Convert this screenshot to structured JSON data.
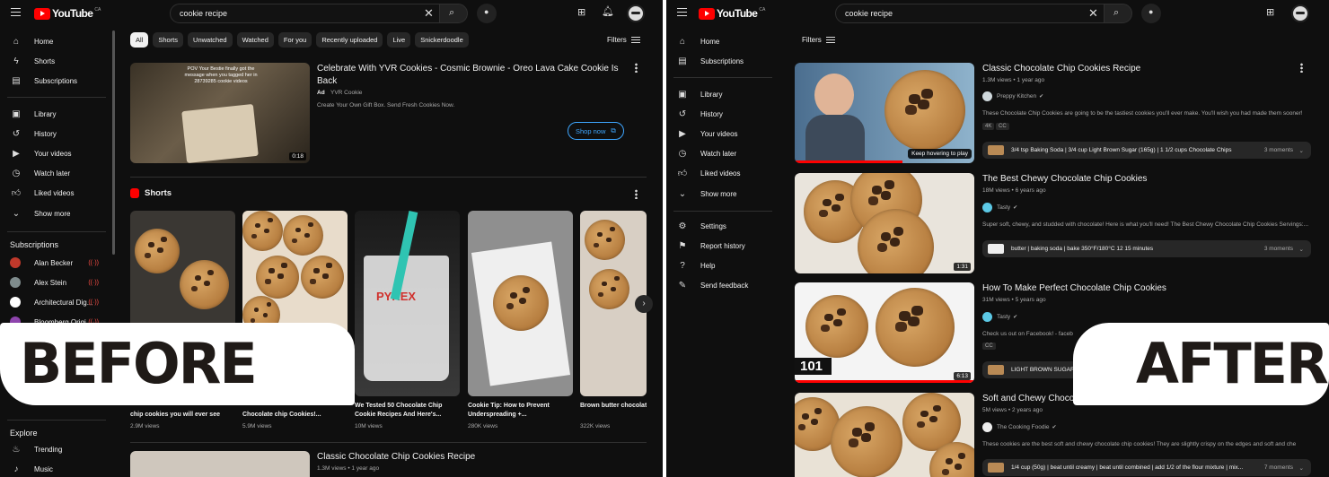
{
  "left": {
    "search_text": "cookie recipe",
    "logo_text": "YouTube",
    "logo_region": "CA",
    "sidebar": {
      "main": [
        {
          "label": "Home",
          "icon": "home-icon"
        },
        {
          "label": "Shorts",
          "icon": "shorts-icon"
        },
        {
          "label": "Subscriptions",
          "icon": "subscriptions-icon"
        }
      ],
      "you": [
        {
          "label": "Library",
          "icon": "library-icon"
        },
        {
          "label": "History",
          "icon": "history-icon"
        },
        {
          "label": "Your videos",
          "icon": "your-videos-icon"
        },
        {
          "label": "Watch later",
          "icon": "watch-later-icon"
        },
        {
          "label": "Liked videos",
          "icon": "liked-videos-icon"
        },
        {
          "label": "Show more",
          "icon": "chevron-down-icon"
        }
      ],
      "subscriptions_heading": "Subscriptions",
      "subscriptions": [
        {
          "label": "Alan Becker",
          "color": "#c0392b"
        },
        {
          "label": "Alex Stein",
          "color": "#7f8c8d"
        },
        {
          "label": "Architectural Dig...",
          "color": "#ffffff"
        },
        {
          "label": "Bloomberg Origi...",
          "color": "#8e44ad"
        }
      ],
      "explore_heading": "Explore",
      "explore": [
        {
          "label": "Trending",
          "icon": "trending-icon"
        },
        {
          "label": "Music",
          "icon": "music-icon"
        }
      ]
    },
    "chips": [
      "All",
      "Shorts",
      "Unwatched",
      "Watched",
      "For you",
      "Recently uploaded",
      "Live",
      "Snickerdoodle"
    ],
    "filters_label": "Filters",
    "ad": {
      "title": "Celebrate With YVR Cookies - Cosmic Brownie - Oreo Lava Cake Cookie Is Back",
      "ad_label": "Ad",
      "channel": "YVR Cookie",
      "description": "Create Your Own Gift Box. Send Fresh Cookies Now.",
      "duration": "0:18",
      "cta": "Shop now",
      "thumb_caption": "POV Your Bestie finally got the message when you tagged her in 28739285 cookie videos"
    },
    "shorts_heading": "Shorts",
    "shorts": [
      {
        "title": "chip cookies you will ever see",
        "views": "2.9M views"
      },
      {
        "title": "Chocolate chip Cookies!...",
        "views": "5.9M views"
      },
      {
        "title": "We Tested 50 Chocolate Chip Cookie Recipes And Here's...",
        "views": "10M views"
      },
      {
        "title": "Cookie Tip: How to Prevent Underspreading +...",
        "views": "280K views"
      },
      {
        "title": "Brown butter chocolate cookies the best you'...",
        "views": "322K views"
      }
    ],
    "pyrex_label": "PYREX",
    "bottom_video": {
      "title": "Classic Chocolate Chip Cookies Recipe",
      "meta": "1.3M views • 1 year ago"
    },
    "banner": "BEFORE"
  },
  "right": {
    "search_text": "cookie recipe",
    "logo_text": "YouTube",
    "logo_region": "CA",
    "sidebar": {
      "main": [
        {
          "label": "Home",
          "icon": "home-icon"
        },
        {
          "label": "Subscriptions",
          "icon": "subscriptions-icon"
        }
      ],
      "you": [
        {
          "label": "Library",
          "icon": "library-icon"
        },
        {
          "label": "History",
          "icon": "history-icon"
        },
        {
          "label": "Your videos",
          "icon": "your-videos-icon"
        },
        {
          "label": "Watch later",
          "icon": "watch-later-icon"
        },
        {
          "label": "Liked videos",
          "icon": "liked-videos-icon"
        },
        {
          "label": "Show more",
          "icon": "chevron-down-icon"
        }
      ],
      "more": [
        {
          "label": "Settings",
          "icon": "gear-icon"
        },
        {
          "label": "Report history",
          "icon": "flag-icon"
        },
        {
          "label": "Help",
          "icon": "help-icon"
        },
        {
          "label": "Send feedback",
          "icon": "feedback-icon"
        }
      ]
    },
    "filters_label": "Filters",
    "videos": [
      {
        "title": "Classic Chocolate Chip Cookies Recipe",
        "meta": "1.3M views • 1 year ago",
        "channel": "Preppy Kitchen",
        "description": "These Chocolate Chip Cookies are going to be the tastiest cookies you'll ever make. You'll wish you had made them sooner!",
        "badges": [
          "4K",
          "CC"
        ],
        "key_moments": "3/4 tsp Baking Soda | 3/4 cup Light Brown Sugar (165g) | 1 1/2 cups Chocolate Chips",
        "moments_count": "3 moments",
        "hover_text": "Keep hovering to play"
      },
      {
        "title": "The Best Chewy Chocolate Chip Cookies",
        "meta": "18M views • 6 years ago",
        "channel": "Tasty",
        "description": "Super soft, chewy, and studded with chocolate! Here is what you'll need! The Best Chewy Chocolate Chip Cookies Servings:...",
        "key_moments": "butter | baking soda | bake 350°F/180°C 12 15 minutes",
        "moments_count": "3 moments",
        "duration": "1:31"
      },
      {
        "title": "How To Make Perfect Chocolate Chip Cookies",
        "meta": "31M views • 5 years ago",
        "channel": "Tasty",
        "description": "Check us out on Facebook! - faceb",
        "badges": [
          "CC"
        ],
        "key_moments": "LIGHT BROWN SUGAR",
        "duration": "6:13",
        "thumb_label": "101"
      },
      {
        "title": "Soft and Chewy Chocolate",
        "meta": "5M views • 2 years ago",
        "channel": "The Cooking Foodie",
        "description": "These cookies are the best soft and chewy chocolate chip cookies! They are slightly crispy on the edges and soft and che",
        "key_moments": "1/4 cup (50g) | beat until creamy | beat until combined | add 1/2 of the flour mixture | mix...",
        "moments_count": "7 moments"
      }
    ],
    "banner": "AFTER"
  }
}
